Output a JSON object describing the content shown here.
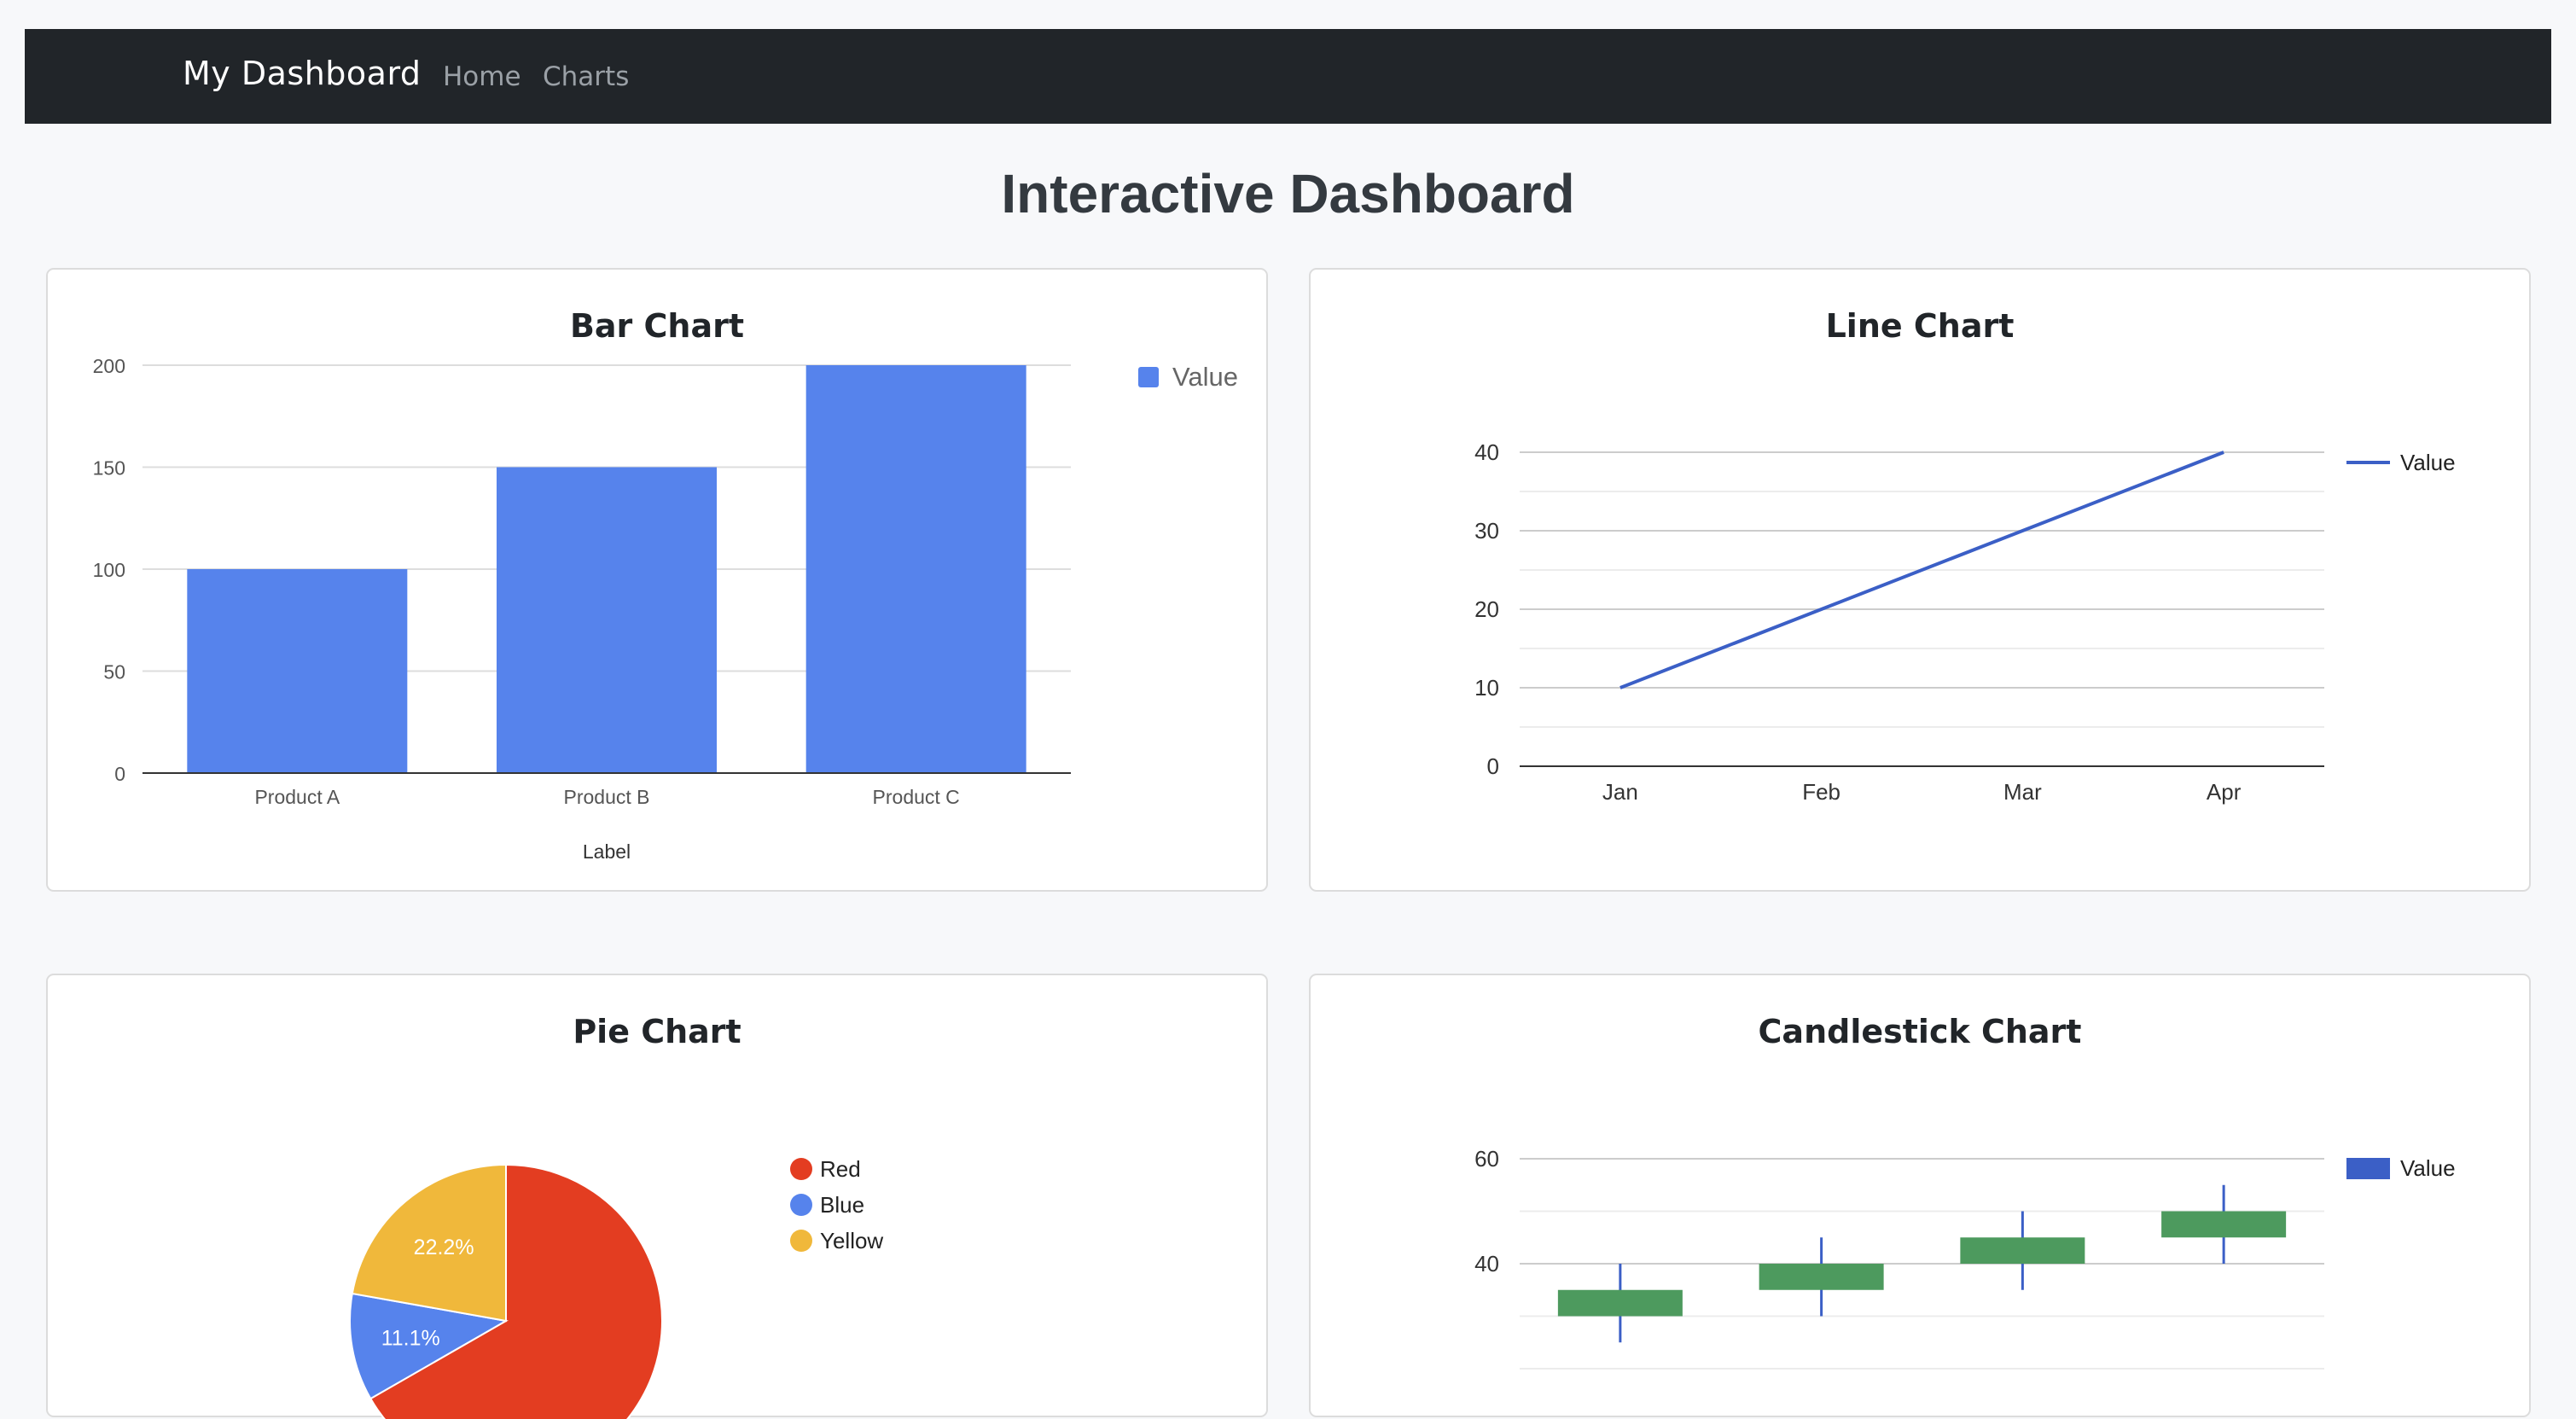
{
  "navbar": {
    "brand": "My Dashboard",
    "links": [
      "Home",
      "Charts"
    ]
  },
  "page_title": "Interactive Dashboard",
  "colors": {
    "navbar_bg": "#212529",
    "bar_blue": "#5683ec",
    "line_blue": "#3b5fc6",
    "pie_red": "#e33d21",
    "pie_blue": "#5683ec",
    "pie_yellow": "#f0b83b",
    "candle_green": "#4d9a5e",
    "candle_wick": "#3b5fc6"
  },
  "cards": {
    "bar": {
      "title": "Bar Chart"
    },
    "line": {
      "title": "Line Chart"
    },
    "pie": {
      "title": "Pie Chart"
    },
    "candle": {
      "title": "Candlestick Chart"
    }
  },
  "chart_data": [
    {
      "type": "bar",
      "title": "Bar Chart",
      "categories": [
        "Product A",
        "Product B",
        "Product C"
      ],
      "series": [
        {
          "name": "Value",
          "values": [
            100,
            150,
            200
          ]
        }
      ],
      "xlabel": "Label",
      "ylabel": "",
      "ylim": [
        0,
        200
      ],
      "yticks": [
        0,
        50,
        100,
        150,
        200
      ],
      "grid": true,
      "legend": "top-right"
    },
    {
      "type": "line",
      "title": "Line Chart",
      "categories": [
        "Jan",
        "Feb",
        "Mar",
        "Apr"
      ],
      "series": [
        {
          "name": "Value",
          "values": [
            10,
            20,
            30,
            40
          ]
        }
      ],
      "xlabel": "",
      "ylabel": "",
      "ylim": [
        0,
        40
      ],
      "yticks": [
        0,
        10,
        20,
        30,
        40
      ],
      "grid": true,
      "legend": "right"
    },
    {
      "type": "pie",
      "title": "Pie Chart",
      "labels": [
        "Red",
        "Blue",
        "Yellow"
      ],
      "values": [
        66.7,
        11.1,
        22.2
      ],
      "slice_labels": [
        "",
        "11.1%",
        "22.2%"
      ],
      "legend": "right"
    },
    {
      "type": "candlestick",
      "title": "Candlestick Chart",
      "categories": [
        "",
        "",
        "",
        ""
      ],
      "series": [
        {
          "name": "Value",
          "low": [
            25,
            30,
            35,
            40
          ],
          "open": [
            30,
            35,
            40,
            45
          ],
          "close": [
            35,
            40,
            45,
            50
          ],
          "high": [
            40,
            45,
            50,
            55
          ]
        }
      ],
      "yticks": [
        40,
        60
      ],
      "ylim": [
        20,
        65
      ],
      "grid": true,
      "legend": "right"
    }
  ]
}
